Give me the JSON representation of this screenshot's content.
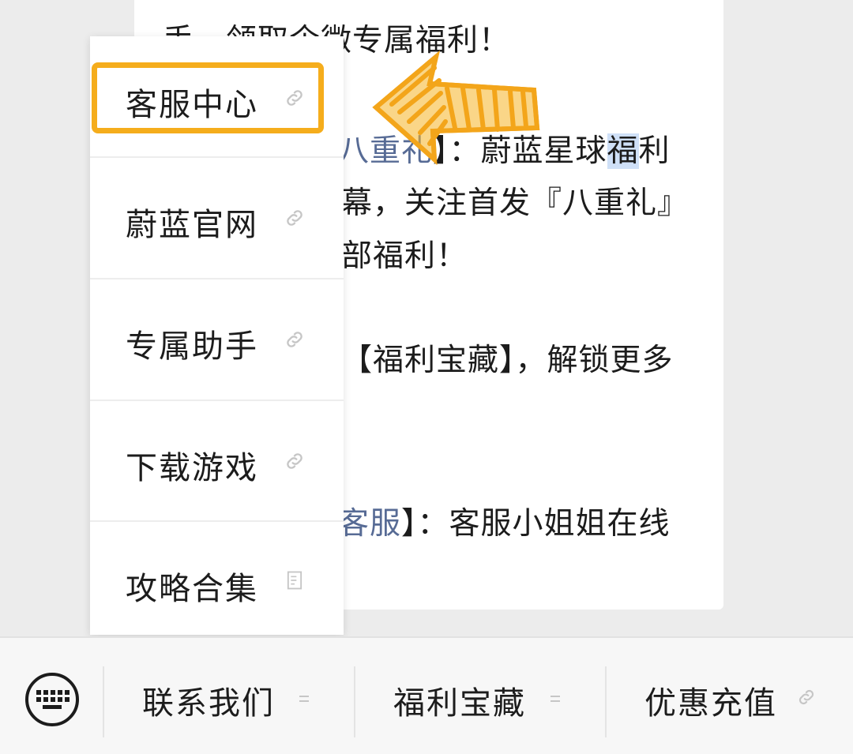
{
  "article": {
    "line1": "手，领取企微专属福利！",
    "line2_bracket": "八重礼",
    "line2_rest": "】：蔚蓝星球",
    "line2_hl": "福",
    "line2_tail": "利",
    "line3": "幕，关注首发『八重礼』",
    "line4": "部福利！",
    "line5": "【福利宝藏】，解锁更多",
    "line6_link": "客服",
    "line6_rest": "】：客服小姐姐在线"
  },
  "popup_menu": {
    "items": [
      {
        "label": "客服中心",
        "icon": "link-icon"
      },
      {
        "label": "蔚蓝官网",
        "icon": "link-icon"
      },
      {
        "label": "专属助手",
        "icon": "link-icon"
      },
      {
        "label": "下载游戏",
        "icon": "link-icon"
      },
      {
        "label": "攻略合集",
        "icon": "article-icon"
      }
    ]
  },
  "bottom_menu": {
    "keyboard_icon": "keyboard-icon",
    "tabs": [
      {
        "label": "联系我们",
        "icon": "submenu-icon"
      },
      {
        "label": "福利宝藏",
        "icon": "submenu-icon"
      },
      {
        "label": "优惠充值",
        "icon": "link-icon"
      }
    ]
  },
  "colors": {
    "highlight": "#f5ad1c",
    "link": "#576b95"
  }
}
